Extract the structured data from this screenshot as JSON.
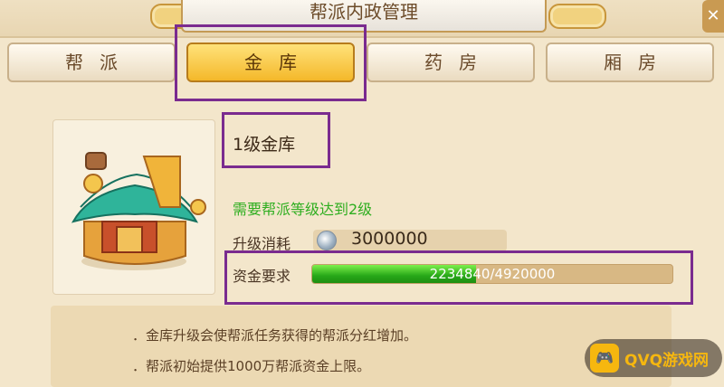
{
  "window": {
    "title": "帮派内政管理",
    "close_label": "✕"
  },
  "tabs": [
    {
      "label": "帮派",
      "active": false
    },
    {
      "label": "金库",
      "active": true
    },
    {
      "label": "药房",
      "active": false
    },
    {
      "label": "厢房",
      "active": false
    }
  ],
  "building": {
    "icon": "treasury-building-icon",
    "title": "1级金库",
    "requirement": "需要帮派等级达到2级",
    "upgrade_cost_label": "升级消耗",
    "upgrade_cost_icon": "silver-coin-icon",
    "upgrade_cost_value": "3000000",
    "fund_label": "资金要求",
    "fund_progress_text": "2234840/4920000",
    "fund_current": 2234840,
    "fund_required": 4920000
  },
  "description": [
    "．金库升级会使帮派任务获得的帮派分红增加。",
    "．帮派初始提供1000万帮派资金上限。"
  ],
  "watermark": {
    "icon": "gamepad-icon",
    "text": "QVQ游戏网"
  },
  "colors": {
    "requirement_text": "#2fae20",
    "active_tab": "#f4b82a",
    "progress_fill": "#27a818",
    "highlight": "#7a2b8f"
  }
}
